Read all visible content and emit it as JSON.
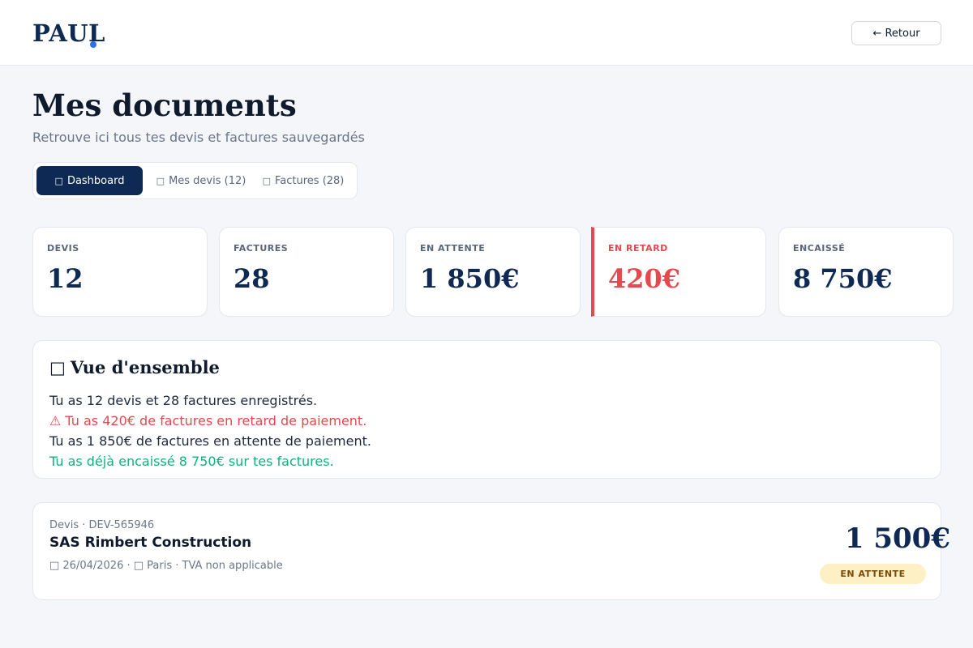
{
  "header": {
    "logo": "PAUL",
    "back_label": "← Retour"
  },
  "page": {
    "title": "Mes documents",
    "subtitle": "Retrouve ici tous tes devis et factures sauvegardés"
  },
  "tabs": [
    {
      "icon": "□",
      "label": "Dashboard",
      "active": true
    },
    {
      "icon": "□",
      "label": "Mes devis (12)",
      "active": false
    },
    {
      "icon": "□",
      "label": "Factures (28)",
      "active": false
    }
  ],
  "stats": [
    {
      "label": "DEVIS",
      "value": "12"
    },
    {
      "label": "FACTURES",
      "value": "28"
    },
    {
      "label": "EN ATTENTE",
      "value": "1 850€"
    },
    {
      "label": "EN RETARD",
      "value": "420€",
      "alert": true
    },
    {
      "label": "ENCAISSÉ",
      "value": "8 750€"
    }
  ],
  "overview": {
    "icon": "□",
    "title": "Vue d'ensemble",
    "lines": [
      "Tu as 12 devis et 28 factures enregistrés.",
      "⚠ Tu as 420€ de factures en retard de paiement.",
      "Tu as 1 850€ de factures en attente de paiement.",
      "Tu as déjà encaissé 8 750€ sur tes factures."
    ]
  },
  "documents": [
    {
      "type_ref": "Devis · DEV-565946",
      "client": "SAS Rimbert Construction",
      "meta": "□ 26/04/2026 · □ Paris · TVA non applicable",
      "amount": "1 500€",
      "status": "EN ATTENTE"
    }
  ],
  "colors": {
    "brand": "#0e2a54",
    "accent_dot": "#2f6fe8",
    "alert": "#e5484d",
    "success": "#14b07c",
    "pending_badge_bg": "#fdf0c4"
  }
}
